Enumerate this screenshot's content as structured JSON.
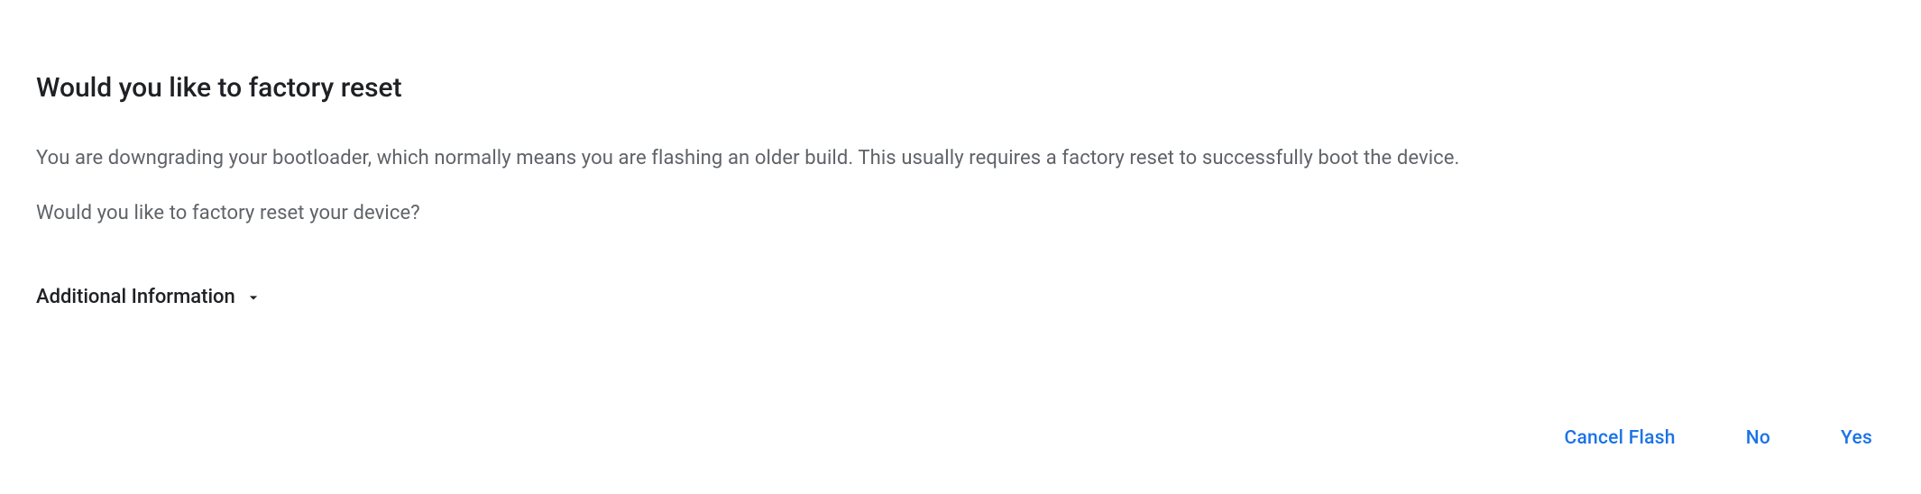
{
  "dialog": {
    "title": "Would you like to factory reset",
    "body_line1": "You are downgrading your bootloader, which normally means you are flashing an older build. This usually requires a factory reset to successfully boot the device.",
    "body_line2": "Would you like to factory reset your device?",
    "expandable_label": "Additional Information"
  },
  "buttons": {
    "cancel": "Cancel Flash",
    "no": "No",
    "yes": "Yes"
  }
}
